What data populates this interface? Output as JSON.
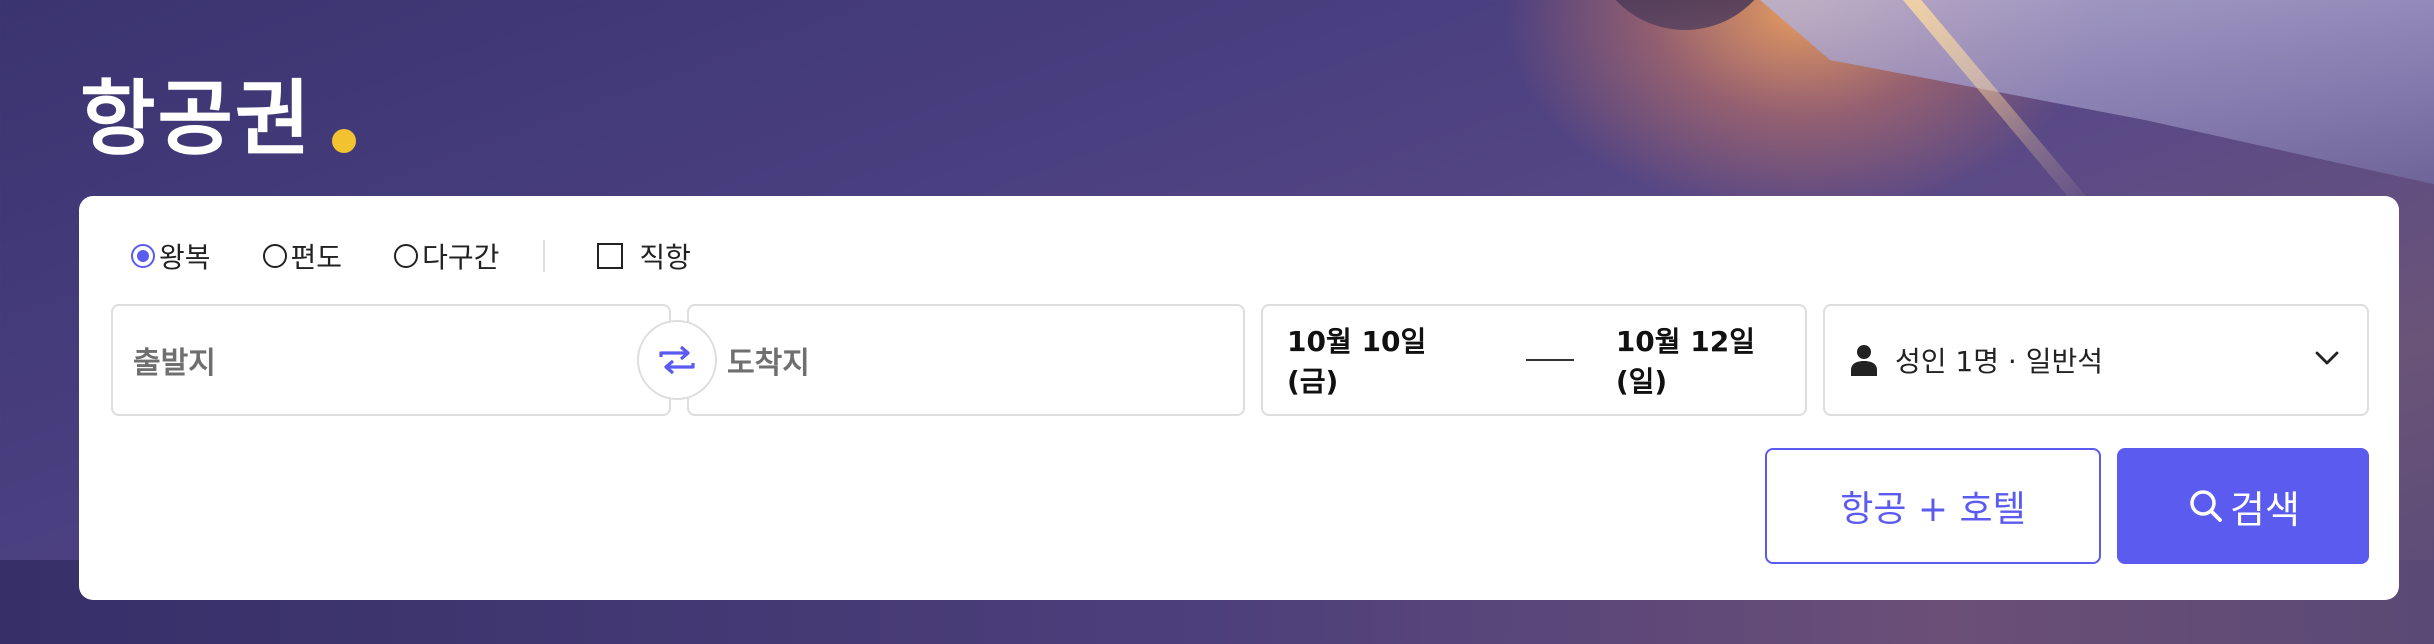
{
  "header": {
    "title": "항공권"
  },
  "trip_types": [
    {
      "label": "왕복",
      "selected": true
    },
    {
      "label": "편도",
      "selected": false
    },
    {
      "label": "다구간",
      "selected": false
    }
  ],
  "direct_filter": {
    "label": "직항",
    "checked": false
  },
  "search": {
    "origin_placeholder": "출발지",
    "destination_placeholder": "도착지",
    "departure_date": "10월 10일(금)",
    "return_date": "10월 12일(일)",
    "passengers": "성인 1명 · 일반석"
  },
  "buttons": {
    "combo_label": "항공 + 호텔",
    "search_label": "검색"
  },
  "icons": [
    "swap-icon",
    "person-icon",
    "chevron-down-icon",
    "search-icon"
  ],
  "colors": {
    "accent": "#5b5bf0",
    "title_dot": "#f2c230",
    "text": "#222222",
    "placeholder": "#6f6f6f"
  }
}
